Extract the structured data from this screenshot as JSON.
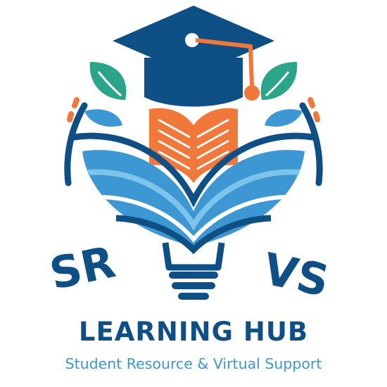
{
  "logo": {
    "initials_left": "SR",
    "initials_right": "VS",
    "title": "LEARNING HUB",
    "subtitle": "Student Resource & Virtual Support",
    "colors": {
      "navy": "#0e4f86",
      "orange": "#f0783a",
      "teal": "#2aa58a",
      "blue": "#3d97d3",
      "light_blue": "#7cc4ec"
    },
    "icons": [
      "graduation-cap-icon",
      "open-book-icon",
      "lightbulb-icon",
      "leaf-icon"
    ]
  }
}
